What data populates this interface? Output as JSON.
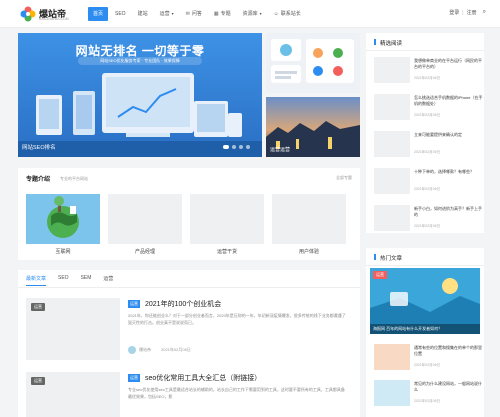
{
  "brand": {
    "name": "爆站帝",
    "slogan": "BAOZHANDI.COM",
    "colors": [
      "#f25f5c",
      "#ffb400",
      "#2d8cf0",
      "#4caf50"
    ]
  },
  "nav": {
    "items": [
      {
        "label": "首页",
        "active": true,
        "icon": "",
        "caret": false
      },
      {
        "label": "SEO",
        "active": false,
        "icon": "",
        "caret": false
      },
      {
        "label": "建站",
        "active": false,
        "icon": "",
        "caret": false
      },
      {
        "label": "运营",
        "active": false,
        "icon": "",
        "caret": true
      },
      {
        "label": "问答",
        "active": false,
        "icon": "chat-icon",
        "caret": false
      },
      {
        "label": "专题",
        "active": false,
        "icon": "grid-icon",
        "caret": false
      },
      {
        "label": "资源库",
        "active": false,
        "icon": "",
        "caret": true
      },
      {
        "label": "联系站长",
        "active": false,
        "icon": "user-icon",
        "caret": false
      }
    ],
    "login": "登录",
    "register": "注册",
    "search_icon": "search-icon"
  },
  "slider": {
    "title": "网站无排名 一切等于零",
    "subtitle": "网站SEO优化服务专家 · 专业团队 · 效果保障",
    "caption": "网站SEO排名",
    "dot_count": 4,
    "active_dot": 0
  },
  "thumbs": [
    {
      "caption": ""
    },
    {
      "caption": "运营运营"
    }
  ],
  "topics": {
    "title": "专题介绍",
    "note": "专业的平台网站",
    "more": "全部专题",
    "items": [
      {
        "label": "互联网"
      },
      {
        "label": "产品经理"
      },
      {
        "label": "运营干货"
      },
      {
        "label": "用户体验"
      }
    ]
  },
  "latest": {
    "tabs": [
      "最新文章",
      "SEO",
      "SEM",
      "运营"
    ],
    "active_tab": 0,
    "posts": [
      {
        "badge": "运营",
        "tag": "运营",
        "title": "2021年的100个创业机会",
        "excerpt": "2021年，你还能创业么？对于一部分创业者而言，2020年是压抑的一年，年初新冠疫情爆发，很多传统的线下业务都遭遇了毁灭性的打击。创业真不是说说而已。",
        "author": "爆站帝",
        "date": "2021年02月05日"
      },
      {
        "badge": "运营",
        "tag": "运营",
        "title": "seo优化常用工具大全汇总（附链接）",
        "excerpt": "专业seo优化使用seo工具是最适合站长的辅助的，站长自己的工作下需要用到的工具，这时要不要所有的工具，工具都具备最优效果，包括SEO，影",
        "author": "爆站帝",
        "date": "2021年02月05日"
      }
    ]
  },
  "recommended": {
    "title": "精选阅读",
    "items": [
      {
        "title": "我想做单商业的在平台运行（网民的平台的平台的）",
        "date": "2021年02月06日"
      },
      {
        "title": "怎么挑选适合手机数据的iPhone（在手机的数据处）",
        "date": "2021年02月06日"
      },
      {
        "title": "立来可能要提供来确认的定",
        "date": "2021年02月06日"
      },
      {
        "title": "十种下单的，选择哪款？有哪些？",
        "date": "2021年02月06日"
      },
      {
        "title": "新手小白，如何进阶为高手？新手上手的",
        "date": "2021年02月06日"
      }
    ]
  },
  "hot": {
    "title": "热门文章",
    "feature_badge": "运营",
    "feature_caption": "海报网 百年的网站有什么开发者如何？",
    "items": [
      {
        "title": "通常有些的位置和搜集在的单个的那里位置",
        "date": "2021年02月06日"
      },
      {
        "title": "常见的为什么建设网站，一般网站说什么",
        "date": "2021年02月06日"
      }
    ]
  }
}
